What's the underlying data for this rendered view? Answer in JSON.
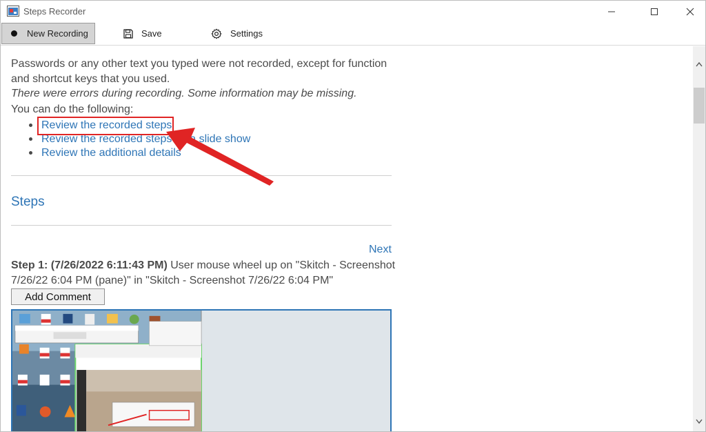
{
  "window": {
    "title": "Steps Recorder"
  },
  "toolbar": {
    "new_recording_label": "New Recording",
    "save_label": "Save",
    "settings_label": "Settings"
  },
  "doc": {
    "info_text": "Passwords or any other text you typed were not recorded, except for function and shortcut keys that you used.",
    "error_text": "There were errors during recording. Some information may be missing.",
    "options_heading": "You can do the following:",
    "links": [
      {
        "label": "Review the recorded steps"
      },
      {
        "label": "Review the recorded steps as a slide show"
      },
      {
        "label": "Review the additional details"
      }
    ],
    "steps_heading": "Steps",
    "next_label": "Next",
    "step1": {
      "label": "Step 1: (7/26/2022 6:11:43 PM)",
      "description": "User mouse wheel up on \"Skitch - Screenshot 7/26/22 6:04 PM (pane)\" in \"Skitch - Screenshot 7/26/22 6:04 PM\""
    },
    "add_comment_label": "Add Comment"
  },
  "colors": {
    "link": "#2e75b6",
    "highlight": "#e02424",
    "text": "#4a4a4a"
  }
}
